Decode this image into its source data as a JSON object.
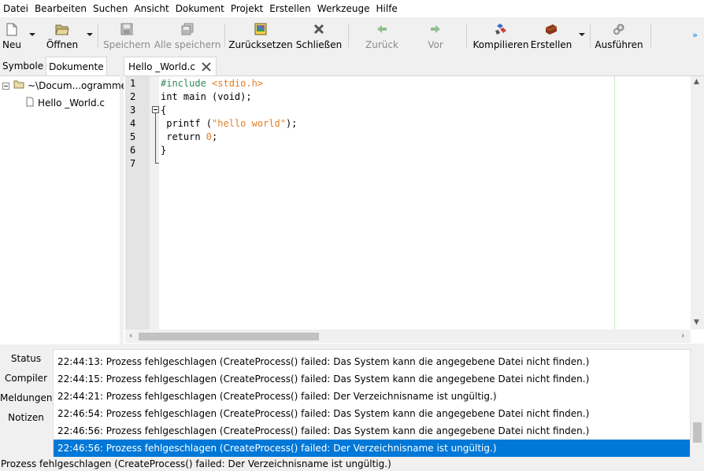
{
  "menu": [
    "Datei",
    "Bearbeiten",
    "Suchen",
    "Ansicht",
    "Dokument",
    "Projekt",
    "Erstellen",
    "Werkzeuge",
    "Hilfe"
  ],
  "toolbar": {
    "new": "Neu",
    "open": "Öffnen",
    "save": "Speichern",
    "save_all": "Alle speichern",
    "revert": "Zurücksetzen",
    "close": "Schließen",
    "back": "Zurück",
    "forward": "Vor",
    "compile": "Kompilieren",
    "build": "Erstellen",
    "run": "Ausführen",
    "more": "»"
  },
  "sidebar": {
    "tabs": [
      "Symbole",
      "Dokumente"
    ],
    "active_tab": "Dokumente",
    "folder": "~\\Docum...ogramme",
    "file": "Hello _World.c"
  },
  "editor": {
    "tab_label": "Hello _World.c",
    "line_numbers": [
      "1",
      "2",
      "3",
      "4",
      "5",
      "6",
      "7"
    ]
  },
  "messages": {
    "tabs": [
      "Status",
      "Compiler",
      "Meldungen",
      "Notizen"
    ],
    "active_tab": "Status",
    "rows": [
      "22:44:13: Prozess fehlgeschlagen (CreateProcess() failed: Das System kann die angegebene Datei nicht finden.)",
      "22:44:15: Prozess fehlgeschlagen (CreateProcess() failed: Das System kann die angegebene Datei nicht finden.)",
      "22:44:21: Prozess fehlgeschlagen (CreateProcess() failed: Der Verzeichnisname ist ungültig.)",
      "22:46:54: Prozess fehlgeschlagen (CreateProcess() failed: Das System kann die angegebene Datei nicht finden.)",
      "22:46:56: Prozess fehlgeschlagen (CreateProcess() failed: Das System kann die angegebene Datei nicht finden.)",
      "22:46:56: Prozess fehlgeschlagen (CreateProcess() failed: Der Verzeichnisname ist ungültig.)"
    ],
    "selected_row": 5
  },
  "statusbar": "Prozess fehlgeschlagen (CreateProcess() failed: Der Verzeichnisname ist ungültig.)",
  "colors": {
    "selection": "#0078d7",
    "preprocessor": "#2e8b57",
    "string": "#e67e22"
  }
}
